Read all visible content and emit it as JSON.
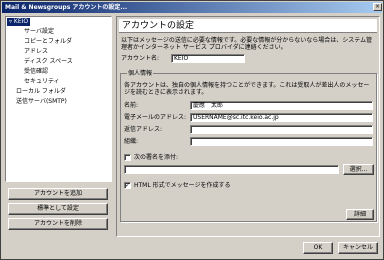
{
  "window": {
    "title": "Mail & Newsgroups アカウントの設定..."
  },
  "tree": {
    "items": [
      {
        "label": "▿ KEIO",
        "selected": true
      },
      {
        "label": "サーバ設定"
      },
      {
        "label": "コピーとフォルダ"
      },
      {
        "label": "アドレス"
      },
      {
        "label": "ディスク スペース"
      },
      {
        "label": "受信確認"
      },
      {
        "label": "セキュリティ"
      },
      {
        "label": "ローカル フォルダ"
      },
      {
        "label": "送信サーバ(SMTP)"
      }
    ]
  },
  "left_buttons": {
    "add": "アカウントを追加",
    "default": "標準として設定",
    "delete": "アカウントを削除"
  },
  "panel": {
    "header": "アカウントの設定",
    "description": "以下はメッセージの送信に必要な情報です。必要な情報が分からないなら場合は、システム管理者かインターネット サービス プロバイダに連絡ください。",
    "account_name_label": "アカウント名:",
    "account_name_value": "KEIO",
    "identity_group": "個人情報",
    "identity_desc": "各アカウントは、独自の個人情報を持つことができます。これは受取人が差出人のメッセージを読むときに表示されます。",
    "name_label": "名前:",
    "name_value": "慶應　太郎",
    "email_label": "電子メールのアドレス:",
    "email_value": "USERNAME@sc.itc.keio.ac.jp",
    "reply_label": "返信アドレス:",
    "reply_value": "",
    "org_label": "組織:",
    "org_value": "",
    "signature_label": "次の署名を添付:",
    "signature_checked": false,
    "signature_path": "",
    "browse_button": "選択...",
    "html_label": "HTML 形式でメッセージを作成する",
    "html_checked": true,
    "advanced_button": "詳細"
  },
  "footer": {
    "ok": "OK",
    "cancel": "キャンセル"
  }
}
